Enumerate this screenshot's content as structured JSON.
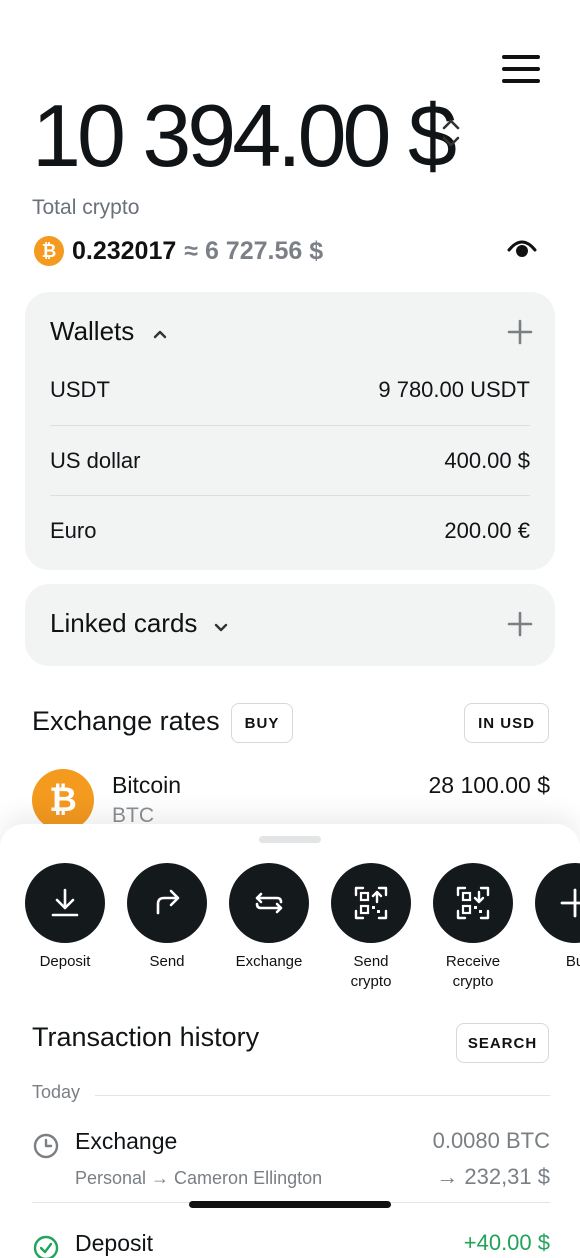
{
  "header": {
    "balance": "10 394.00 $"
  },
  "total_crypto": {
    "label": "Total crypto",
    "coin_symbol": "₿",
    "amount": "0.232017",
    "approx": "≈ 6 727.56 $"
  },
  "wallets": {
    "title": "Wallets",
    "items": [
      {
        "name": "USDT",
        "amount": "9 780.00 USDT"
      },
      {
        "name": "US dollar",
        "amount": "400.00 $"
      },
      {
        "name": "Euro",
        "amount": "200.00 €"
      }
    ]
  },
  "linked_cards": {
    "title": "Linked cards"
  },
  "exchange_rates": {
    "title": "Exchange rates",
    "buy_label": "BUY",
    "currency_label": "IN USD",
    "items": [
      {
        "name": "Bitcoin",
        "ticker": "BTC",
        "price": "28 100.00 $",
        "coin_symbol": "₿"
      }
    ]
  },
  "actions": [
    {
      "label": "Deposit",
      "icon": "download-icon"
    },
    {
      "label": "Send",
      "icon": "forward-arrow-icon"
    },
    {
      "label": "Exchange",
      "icon": "exchange-icon"
    },
    {
      "label": "Send\ncrypto",
      "icon": "qr-send-icon"
    },
    {
      "label": "Receive\ncrypto",
      "icon": "qr-receive-icon"
    },
    {
      "label": "Bu",
      "icon": "plus-icon"
    }
  ],
  "history": {
    "title": "Transaction history",
    "search_label": "SEARCH",
    "day_label": "Today",
    "transactions": [
      {
        "title": "Exchange",
        "subtitle": "Personal → Cameron Ellington",
        "amount": "0.0080 BTC",
        "amount2": "→ 232,31 $",
        "icon": "clock-icon"
      },
      {
        "title": "Deposit",
        "amount": "+40.00 $",
        "icon": "check-circle-icon"
      }
    ]
  },
  "colors": {
    "accent_dark": "#14191c",
    "bitcoin_orange": "#f39a1f",
    "card_bg": "#f2f3f3",
    "positive_green": "#21a35a",
    "muted_text": "#7a7f84"
  }
}
